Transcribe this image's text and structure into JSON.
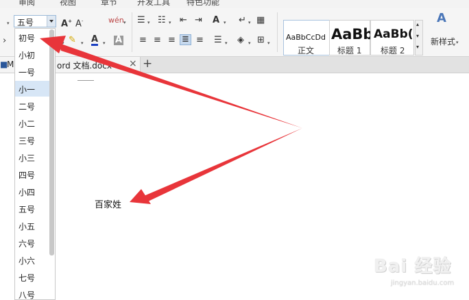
{
  "menu": {
    "items": [
      "审阅",
      "视图",
      "章节",
      "开发工具",
      "特色功能"
    ]
  },
  "toolbar": {
    "font_size_value": "五号",
    "icons": [
      "grow-font-icon",
      "shrink-font-icon",
      "pinyin-icon",
      "bullets-icon",
      "numbering-icon",
      "decrease-indent-icon",
      "increase-indent-icon",
      "text-effect-icon",
      "line-break-icon",
      "table-icon",
      "highlight-icon",
      "font-color-icon",
      "char-shading-icon",
      "align-left-icon",
      "align-center-icon",
      "align-right-icon",
      "justify-icon",
      "line-spacing-icon",
      "shading-icon",
      "borders-icon"
    ],
    "font_color_letter": "A",
    "shading_letter": "A"
  },
  "styles": {
    "items": [
      {
        "sample": "AaBbCcDd",
        "name": "正文"
      },
      {
        "sample": "AaBb",
        "name": "标题 1"
      },
      {
        "sample": "AaBb(",
        "name": "标题 2"
      }
    ],
    "new_style_label": "新样式",
    "new_style_icon_text": "A"
  },
  "tabs": {
    "left_fragment": "M",
    "doc_title": "ord 文档.docx",
    "close_glyph": "×",
    "add_glyph": "+"
  },
  "font_size_dropdown": {
    "options": [
      "初号",
      "小初",
      "一号",
      "小一",
      "二号",
      "小二",
      "三号",
      "小三",
      "四号",
      "小四",
      "五号",
      "小五",
      "六号",
      "小六",
      "七号",
      "八号"
    ],
    "selected": "小一"
  },
  "document": {
    "text": "百家姓"
  },
  "watermark": {
    "main": "Bai 经验",
    "sub": "jingyan.baidu.com"
  },
  "colors": {
    "arrow": "#e8353a",
    "accent_blue": "#2b579a",
    "selected_row": "#d7e6f6"
  }
}
